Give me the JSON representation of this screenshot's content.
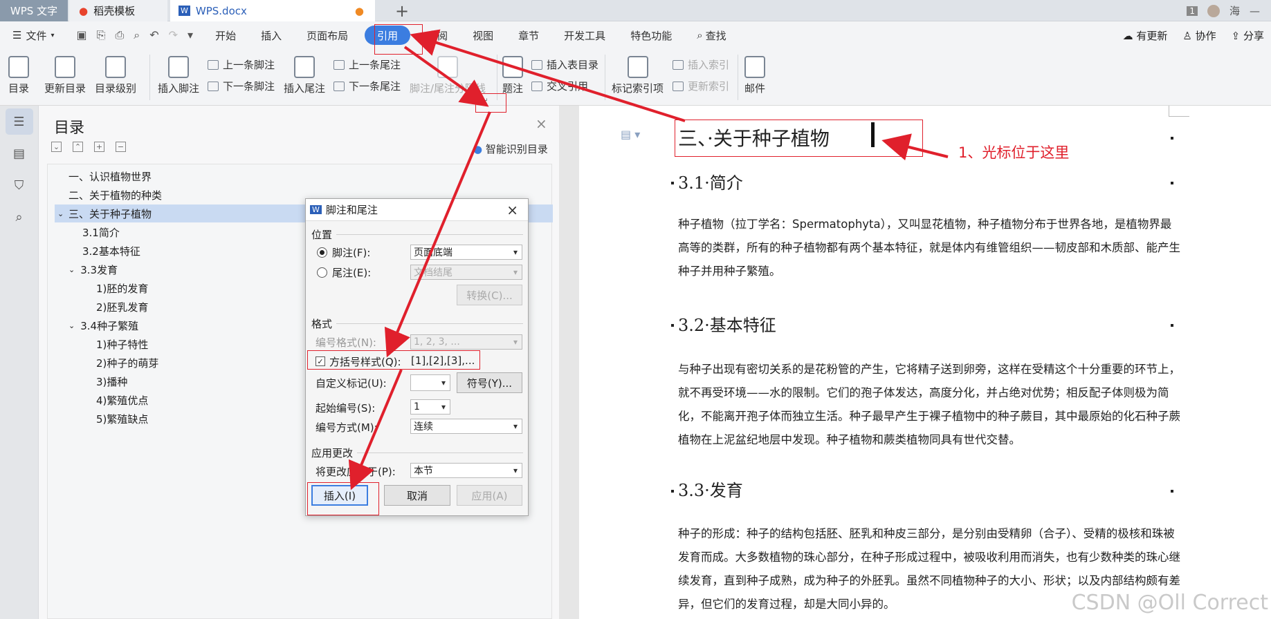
{
  "titlebar": {
    "tabs": [
      "WPS 文字",
      "稻壳模板",
      "WPS.docx"
    ],
    "user": "海",
    "win_count": "1"
  },
  "menu": {
    "file": "文件",
    "items": [
      "开始",
      "插入",
      "页面布局",
      "引用",
      "审阅",
      "视图",
      "章节",
      "开发工具",
      "特色功能",
      "查找"
    ],
    "right": [
      "有更新",
      "协作",
      "分享"
    ]
  },
  "ribbon": {
    "toc": "目录",
    "update_toc": "更新目录",
    "toc_level": "目录级别",
    "insert_footnote": "插入脚注",
    "prev_footnote": "上一条脚注",
    "next_footnote": "下一条脚注",
    "insert_endnote": "插入尾注",
    "prev_endnote": "上一条尾注",
    "next_endnote": "下一条尾注",
    "separator": "脚注/尾注分隔线",
    "caption": "题注",
    "insert_table_toc": "插入表目录",
    "cross_ref": "交叉引用",
    "mark_index": "标记索引项",
    "insert_index": "插入索引",
    "update_index": "更新索引",
    "mail": "邮件"
  },
  "toc_panel": {
    "title": "目录",
    "smart": "智能识别目录",
    "items": [
      "一、认识植物世界",
      "二、关于植物的种类",
      "三、关于种子植物",
      "3.1简介",
      "3.2基本特征",
      "3.3发育",
      "1)胚的发育",
      "2)胚乳发育",
      "3.4种子繁殖",
      "1)种子特性",
      "2)种子的萌芽",
      "3)播种",
      "4)繁殖优点",
      "5)繁殖缺点"
    ]
  },
  "dialog": {
    "title": "脚注和尾注",
    "position": "位置",
    "footnote": "脚注(F):",
    "footnote_val": "页面底端",
    "endnote": "尾注(E):",
    "endnote_val": "文档结尾",
    "convert": "转换(C)...",
    "format": "格式",
    "num_format": "编号格式(N):",
    "num_format_val": "1, 2, 3, ...",
    "bracket": "方括号样式(Q):",
    "bracket_val": "[1],[2],[3],...",
    "custom": "自定义标记(U):",
    "symbol": "符号(Y)...",
    "start": "起始编号(S):",
    "start_val": "1",
    "numbering": "编号方式(M):",
    "numbering_val": "连续",
    "apply_changes": "应用更改",
    "apply_to": "将更改应用于(P):",
    "apply_to_val": "本节",
    "insert": "插入(I)",
    "cancel": "取消",
    "apply": "应用(A)"
  },
  "doc": {
    "h1": "三、·关于种子植物",
    "h2_1": "3.1·简介",
    "p1": "种子植物（拉丁学名：Spermatophyta），又叫显花植物，种子植物分布于世界各地，是植物界最高等的类群，所有的种子植物都有两个基本特征，就是体内有维管组织——韧皮部和木质部、能产生种子并用种子繁殖。",
    "h2_2": "3.2·基本特征",
    "p2": "与种子出现有密切关系的是花粉管的产生，它将精子送到卵旁，这样在受精这个十分重要的环节上，就不再受环境——水的限制。它们的孢子体发达，高度分化，并占绝对优势；相反配子体则极为简化，不能离开孢子体而独立生活。种子最早产生于裸子植物中的种子蕨目，其中最原始的化石种子蕨植物在上泥盆纪地层中发现。种子植物和蕨类植物同具有世代交替。",
    "h2_3": "3.3·发育",
    "p3": "种子的形成：种子的结构包括胚、胚乳和种皮三部分，是分别由受精卵（合子）、受精的极核和珠被发育而成。大多数植物的珠心部分，在种子形成过程中，被吸收利用而消失，也有少数种类的珠心继续发育，直到种子成熟，成为种子的外胚乳。虽然不同植物种子的大小、形状；以及内部结构颇有差异，但它们的发育过程，却是大同小异的。"
  },
  "annotation": "1、光标位于这里",
  "watermark": "CSDN @Oll Correct"
}
